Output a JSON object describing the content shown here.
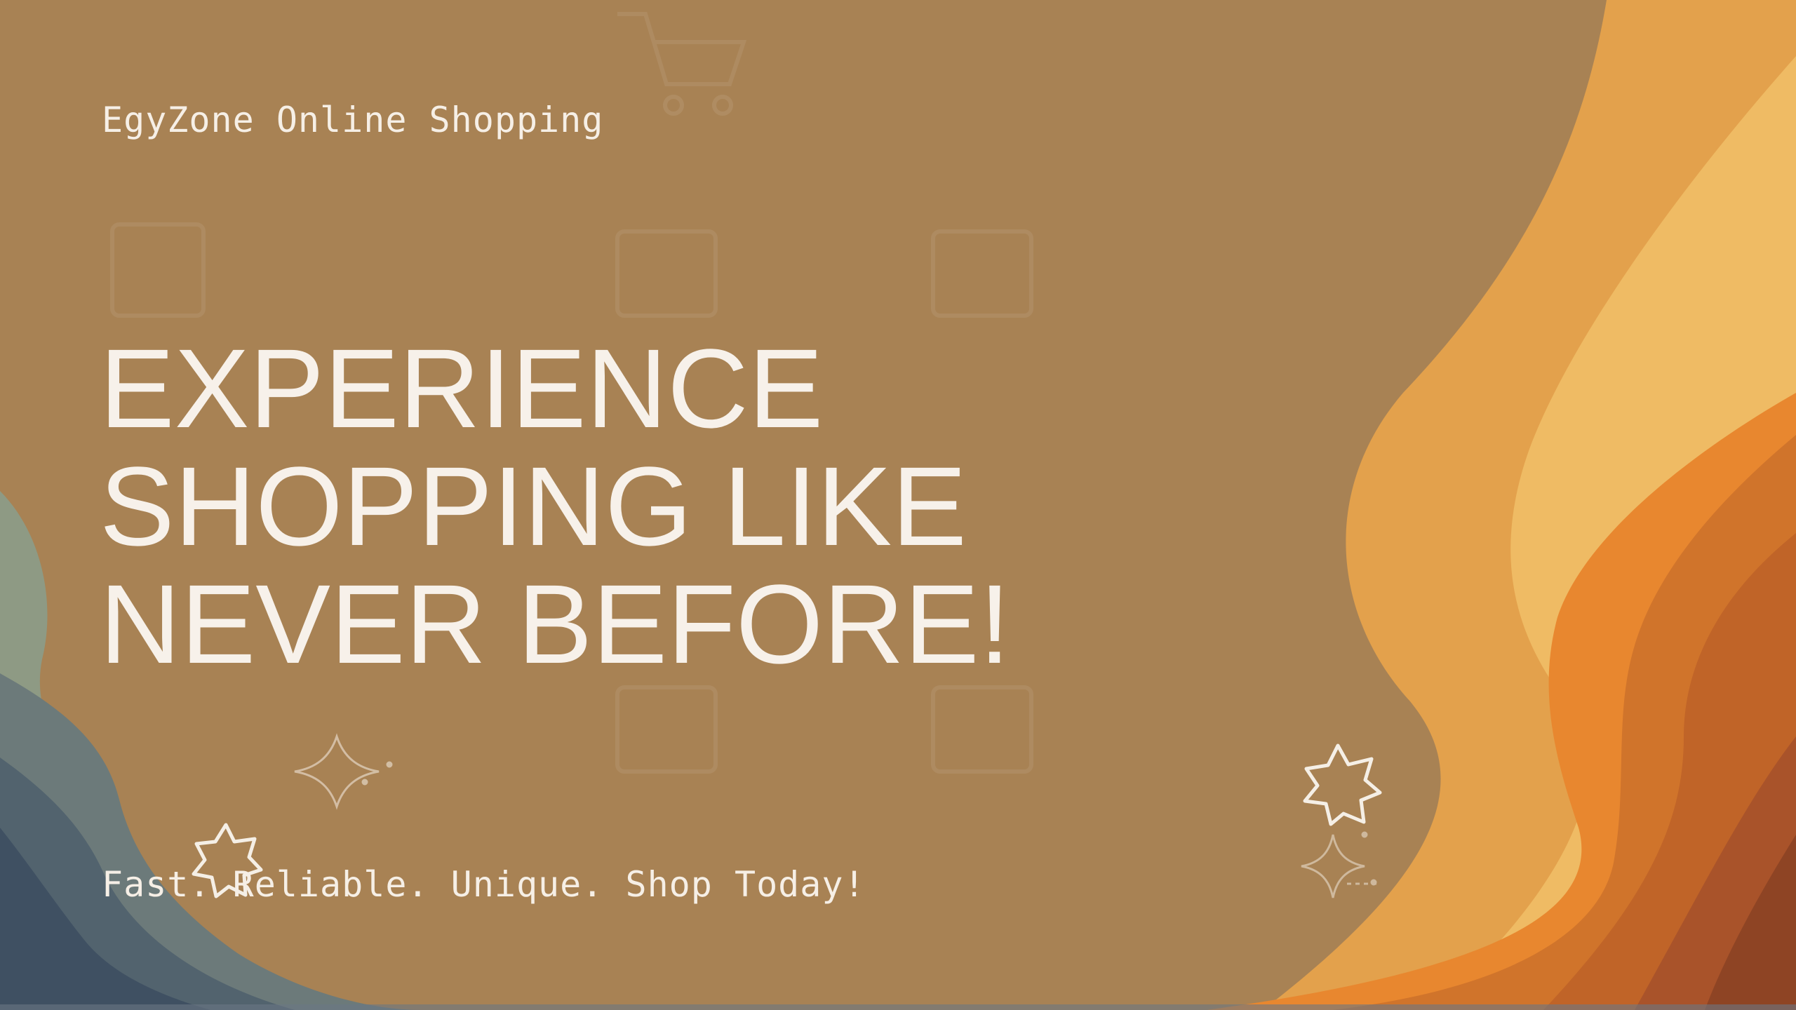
{
  "slide": {
    "brand": "EgyZone Online Shopping",
    "headline_lines": [
      "EXPERIENCE",
      "SHOPPING LIKE",
      "NEVER BEFORE!"
    ],
    "tagline": "Fast. Reliable. Unique. Shop Today!"
  },
  "colors": {
    "background": "#a88254",
    "text": "#f6efe6",
    "wave_orange": "#e8872f",
    "wave_gold": "#e9b25c",
    "wave_rust": "#b25a2a",
    "wave_slate": "#5a6a72",
    "wave_sage": "#8a9a86"
  },
  "icons": [
    "star-burst-icon",
    "sparkle-icon",
    "cart-watermark-icon"
  ]
}
